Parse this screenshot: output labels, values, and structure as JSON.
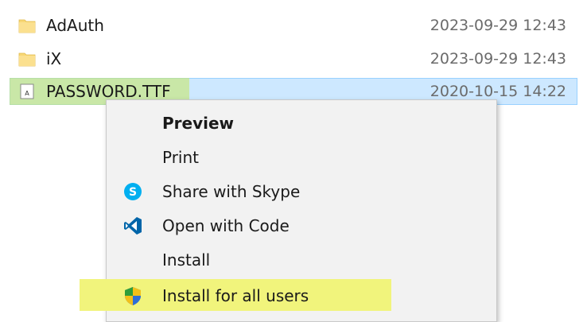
{
  "files": [
    {
      "name": "AdAuth",
      "date": "2023-09-29 12:43",
      "type": "folder"
    },
    {
      "name": "iX",
      "date": "2023-09-29 12:43",
      "type": "folder"
    },
    {
      "name": "PASSWORD.TTF",
      "date": "2020-10-15 14:22",
      "type": "font",
      "selected": true
    }
  ],
  "menu": {
    "items": [
      {
        "label": "Preview",
        "icon": "none",
        "bold": true
      },
      {
        "label": "Print",
        "icon": "none"
      },
      {
        "label": "Share with Skype",
        "icon": "skype-icon"
      },
      {
        "label": "Open with Code",
        "icon": "vscode-icon"
      },
      {
        "label": "Install",
        "icon": "none"
      },
      {
        "label": "Install for all users",
        "icon": "uac-shield-icon",
        "highlighted": true
      }
    ]
  },
  "colors": {
    "selection_bg": "#cde8ff",
    "highlight_green": "#c6e678",
    "highlight_yellow": "#f1f47c",
    "folder": "#f8d775",
    "skype": "#00aff0",
    "vscode": "#0065a9"
  }
}
